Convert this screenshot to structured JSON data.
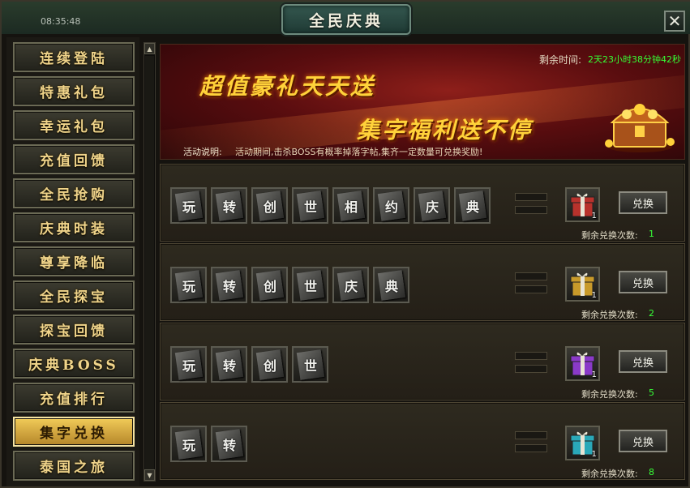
{
  "window": {
    "title": "全民庆典",
    "close_icon": "close-icon",
    "clock": "08:35:48"
  },
  "sidebar": {
    "items": [
      {
        "label": "连续登陆",
        "active": false
      },
      {
        "label": "特惠礼包",
        "active": false
      },
      {
        "label": "幸运礼包",
        "active": false
      },
      {
        "label": "充值回馈",
        "active": false
      },
      {
        "label": "全民抢购",
        "active": false
      },
      {
        "label": "庆典时装",
        "active": false
      },
      {
        "label": "尊享降临",
        "active": false
      },
      {
        "label": "全民探宝",
        "active": false
      },
      {
        "label": "探宝回馈",
        "active": false
      },
      {
        "label": "庆典BOSS",
        "active": false
      },
      {
        "label": "充值排行",
        "active": false
      },
      {
        "label": "集字兑换",
        "active": true
      },
      {
        "label": "泰国之旅",
        "active": false
      }
    ]
  },
  "banner": {
    "time_label": "剩余时间:",
    "time_value": "2天23小时38分钟42秒",
    "slogan_1": "超值豪礼天天送",
    "slogan_2": "集字福利送不停",
    "desc_label": "活动说明:",
    "desc_text": "活动期间,击杀BOSS有概率掉落字帖,集齐一定数量可兑换奖励!"
  },
  "rows": [
    {
      "chars": [
        "玩",
        "转",
        "创",
        "世",
        "相",
        "约",
        "庆",
        "典"
      ],
      "gift_count": "1",
      "gift_color": "#b8322c",
      "button": "兑换",
      "remain_label": "剩余兑换次数:",
      "remain_value": "1"
    },
    {
      "chars": [
        "玩",
        "转",
        "创",
        "世",
        "庆",
        "典"
      ],
      "gift_count": "1",
      "gift_color": "#c89a2a",
      "button": "兑换",
      "remain_label": "剩余兑换次数:",
      "remain_value": "2"
    },
    {
      "chars": [
        "玩",
        "转",
        "创",
        "世"
      ],
      "gift_count": "1",
      "gift_color": "#8a3ac8",
      "button": "兑换",
      "remain_label": "剩余兑换次数:",
      "remain_value": "5"
    },
    {
      "chars": [
        "玩",
        "转"
      ],
      "gift_count": "1",
      "gift_color": "#2aa8b8",
      "button": "兑换",
      "remain_label": "剩余兑换次数:",
      "remain_value": "8"
    }
  ]
}
